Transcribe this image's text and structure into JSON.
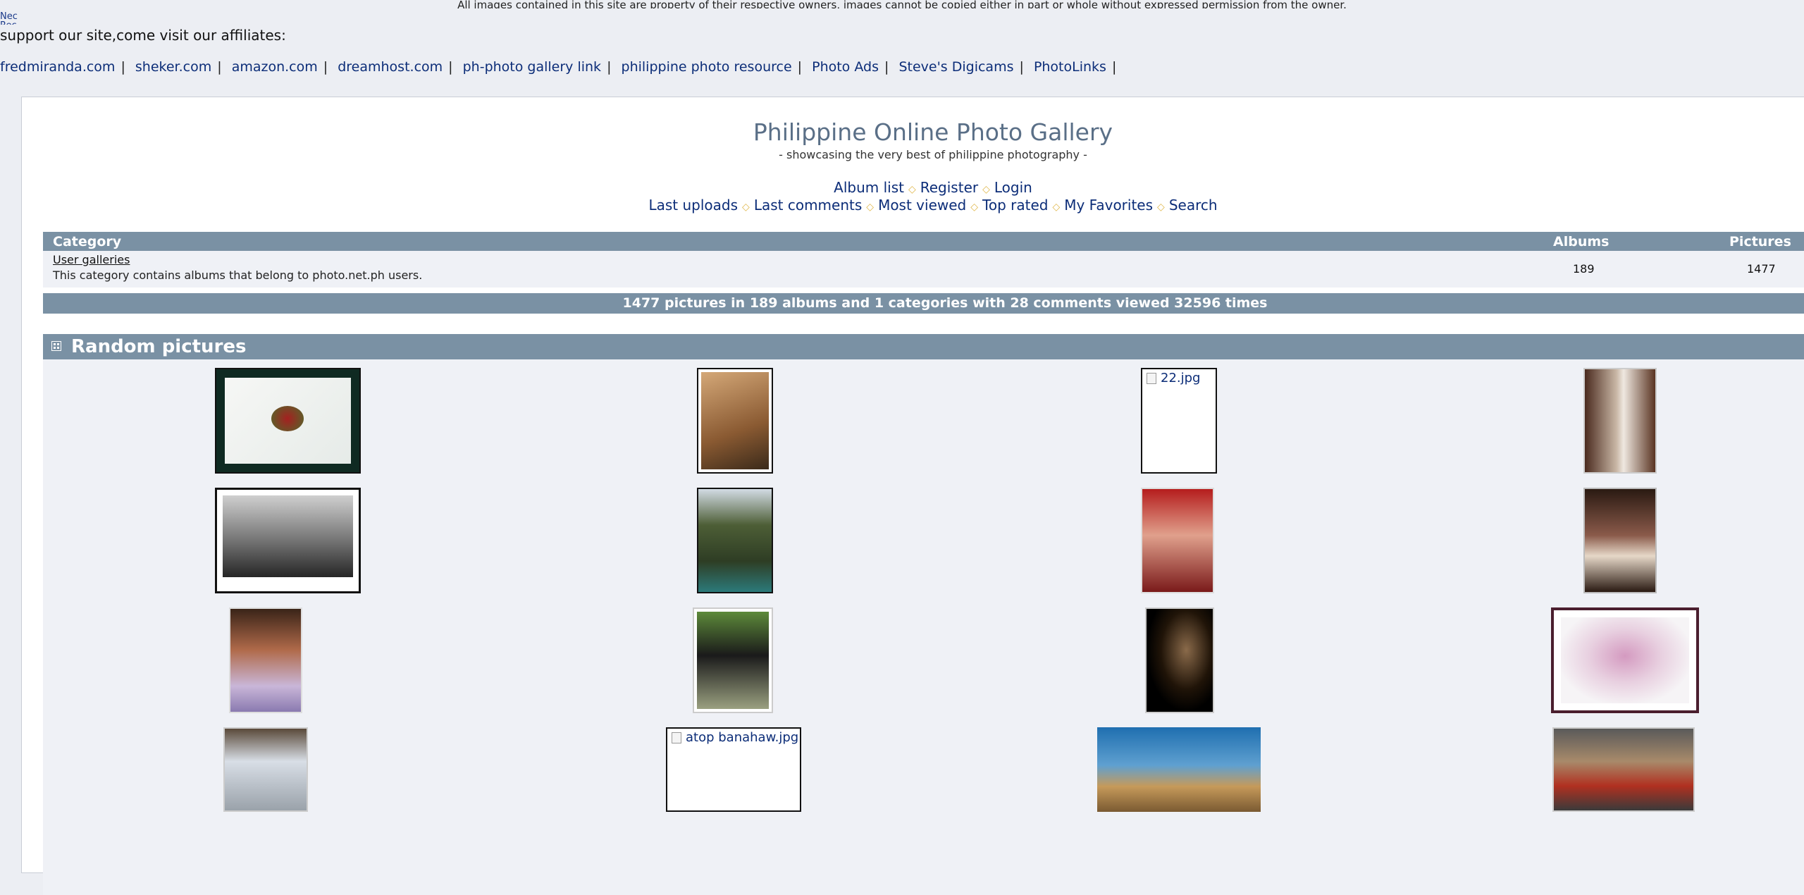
{
  "header": {
    "copyright_notice": "All images contained in this site are property of their respective owners, images cannot be copied either in part or whole without expressed permission from the owner.",
    "tiny_text_1": "Nec",
    "tiny_text_2": "Rec",
    "support_text": "support our site,come visit our affiliates:",
    "affiliates": [
      "fredmiranda.com",
      "sheker.com",
      "amazon.com",
      "dreamhost.com",
      "ph-photo gallery link",
      "philippine photo resource",
      "Photo Ads",
      "Steve's Digicams",
      "PhotoLinks"
    ]
  },
  "gallery": {
    "title": "Philippine Online Photo Gallery",
    "subtitle": "- showcasing the very best of philippine photography -",
    "nav_row1": [
      "Album list",
      "Register",
      "Login"
    ],
    "nav_row2": [
      "Last uploads",
      "Last comments",
      "Most viewed",
      "Top rated",
      "My Favorites",
      "Search"
    ]
  },
  "category_table": {
    "headers": {
      "category": "Category",
      "albums": "Albums",
      "pictures": "Pictures"
    },
    "rows": [
      {
        "name": "User galleries",
        "description": "This category contains albums that belong to photo.net.ph users.",
        "albums": "189",
        "pictures": "1477"
      }
    ],
    "stats": "1477 pictures in 189 albums and 1 categories with 28 comments viewed 32596 times"
  },
  "random_pictures": {
    "title": "Random pictures",
    "broken_images": [
      "22.jpg",
      "atop banahaw.jpg"
    ]
  },
  "colors": {
    "page_bg": "#eceef3",
    "header_bar": "#7a91a4",
    "link": "#0c2d78",
    "title": "#5a6f87",
    "nav_separator": "#e0b84c"
  }
}
